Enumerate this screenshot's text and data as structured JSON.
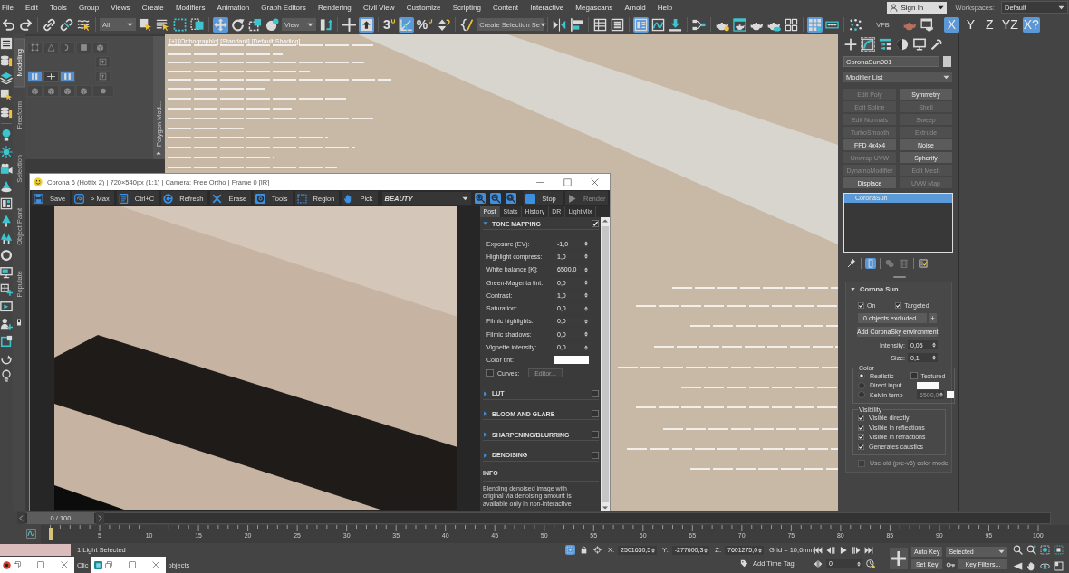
{
  "menu_bar": {
    "items": [
      "File",
      "Edit",
      "Tools",
      "Group",
      "Views",
      "Create",
      "Modifiers",
      "Animation",
      "Graph Editors",
      "Rendering",
      "Civil View",
      "Customize",
      "Scripting",
      "Content",
      "Interactive",
      "Megascans",
      "Arnold",
      "Help"
    ],
    "sign_in": "Sign In",
    "workspaces_label": "Workspaces:",
    "workspace": "Default"
  },
  "main_toolbar": {
    "buttons": [
      {
        "kind": "icon",
        "selected": false
      },
      {
        "kind": "icon",
        "selected": false
      },
      {
        "kind": "icon",
        "selected": false
      },
      {
        "kind": "icon",
        "selected": false
      },
      {
        "kind": "icon",
        "selected": false
      },
      {
        "kind": "dropdown",
        "value": "All"
      },
      {
        "kind": "icon",
        "selected": false
      },
      {
        "kind": "icon",
        "selected": false
      },
      {
        "kind": "icon",
        "selected": false
      },
      {
        "kind": "icon",
        "selected": false
      },
      {
        "kind": "icon",
        "selected": true
      },
      {
        "kind": "icon",
        "selected": false
      },
      {
        "kind": "icon",
        "selected": false
      },
      {
        "kind": "icon",
        "selected": false
      },
      {
        "kind": "dropdown",
        "value": "View"
      },
      {
        "kind": "icon",
        "selected": false
      },
      {
        "kind": "icon",
        "selected": false
      },
      {
        "kind": "icon",
        "selected": true
      },
      {
        "kind": "snap",
        "label": "3",
        "selected": false
      },
      {
        "kind": "icon",
        "selected": true
      },
      {
        "kind": "snap",
        "label": "%",
        "selected": false
      },
      {
        "kind": "icon",
        "selected": false
      },
      {
        "kind": "icon",
        "selected": false
      },
      {
        "kind": "dropdown",
        "value": "Create Selection Se"
      },
      {
        "kind": "icon",
        "selected": false
      },
      {
        "kind": "icon",
        "selected": false
      },
      {
        "kind": "icon",
        "selected": false
      },
      {
        "kind": "icon",
        "selected": false
      },
      {
        "kind": "icon",
        "selected": true
      },
      {
        "kind": "icon",
        "selected": false
      },
      {
        "kind": "icon",
        "selected": false
      },
      {
        "kind": "icon",
        "selected": false
      },
      {
        "kind": "icon",
        "selected": false
      },
      {
        "kind": "icon",
        "selected": false
      },
      {
        "kind": "icon",
        "selected": false
      },
      {
        "kind": "icon",
        "selected": false
      },
      {
        "kind": "icon",
        "selected": false
      },
      {
        "kind": "icon",
        "selected": true
      },
      {
        "kind": "icon",
        "selected": false
      },
      {
        "kind": "icon",
        "selected": false
      },
      {
        "kind": "text",
        "label": "VFB"
      },
      {
        "kind": "icon",
        "selected": false
      },
      {
        "kind": "icon",
        "selected": false
      },
      {
        "kind": "axis",
        "label": "X",
        "selected": true
      },
      {
        "kind": "axis",
        "label": "Y",
        "selected": false
      },
      {
        "kind": "axis",
        "label": "Z",
        "selected": false
      },
      {
        "kind": "axis",
        "label": "YZ",
        "selected": false
      },
      {
        "kind": "axis",
        "label": "X?",
        "selected": true
      }
    ]
  },
  "ribbon": {
    "tabs": [
      {
        "label": "Modeling",
        "selected": true
      },
      {
        "label": "Freeform",
        "selected": false
      },
      {
        "label": "Selection",
        "selected": false
      },
      {
        "label": "Object Paint",
        "selected": false
      },
      {
        "label": "Populate",
        "selected": false
      }
    ],
    "panel": {
      "title": "Polygon Mod...",
      "tools": [
        {
          "selected": false,
          "disabled": true
        },
        {
          "selected": false,
          "disabled": true
        },
        {
          "selected": false,
          "disabled": true
        },
        {
          "selected": false,
          "disabled": true
        },
        {
          "selected": false,
          "disabled": true
        },
        {
          "selected": false,
          "disabled": true
        },
        {
          "selected": true,
          "disabled": false
        },
        {
          "selected": false,
          "disabled": false
        },
        {
          "selected": true,
          "disabled": false
        },
        {
          "selected": false,
          "disabled": true
        },
        {
          "selected": false,
          "disabled": true
        },
        {
          "selected": false,
          "disabled": true
        },
        {
          "selected": false,
          "disabled": true
        },
        {
          "selected": false,
          "disabled": true
        },
        {
          "selected": false,
          "disabled": true
        }
      ]
    }
  },
  "viewport": {
    "labels": [
      "[+]",
      "[Orthographic]",
      "[Standard]",
      "[Default Shading]"
    ]
  },
  "render_window": {
    "title": "Corona 6 (Hotfix 2) | 720×540px (1:1) | Camera: Free Ortho | Frame 0 [IR]",
    "toolbar": [
      {
        "kind": "button",
        "label": "Save",
        "disabled": false
      },
      {
        "kind": "button",
        "label": "> Max",
        "disabled": false
      },
      {
        "kind": "button",
        "label": "Ctrl+C",
        "disabled": false
      },
      {
        "kind": "button",
        "label": "Refresh",
        "disabled": false
      },
      {
        "kind": "button",
        "label": "Erase",
        "disabled": false
      },
      {
        "kind": "button",
        "label": "Tools",
        "disabled": false
      },
      {
        "kind": "button",
        "label": "Region",
        "disabled": false
      },
      {
        "kind": "button",
        "label": "Pick",
        "disabled": false
      },
      {
        "kind": "dropdown",
        "value": "BEAUTY"
      },
      {
        "kind": "icon",
        "disabled": false
      },
      {
        "kind": "icon",
        "disabled": false
      },
      {
        "kind": "icon",
        "disabled": false
      },
      {
        "kind": "button",
        "label": "Stop",
        "disabled": false
      },
      {
        "kind": "button",
        "label": "Render",
        "disabled": true
      }
    ],
    "tabs": [
      {
        "label": "Post",
        "selected": true
      },
      {
        "label": "Stats",
        "selected": false
      },
      {
        "label": "History",
        "selected": false
      },
      {
        "label": "DR",
        "selected": false
      },
      {
        "label": "LightMix",
        "selected": false
      }
    ],
    "tone_mapping": {
      "title": "TONE MAPPING",
      "expanded": true,
      "enabled": true,
      "rows": [
        {
          "kind": "spinner",
          "label": "Exposure (EV):",
          "value": "-1,0"
        },
        {
          "kind": "spinner",
          "label": "Highlight compress:",
          "value": "1,0"
        },
        {
          "kind": "spinner",
          "label": "White balance [K]:",
          "value": "6500,0"
        },
        {
          "kind": "spinner",
          "label": "Green-Magenta tint:",
          "value": "0,0"
        },
        {
          "kind": "spinner",
          "label": "Contrast:",
          "value": "1,0"
        },
        {
          "kind": "spinner",
          "label": "Saturation:",
          "value": "0,0"
        },
        {
          "kind": "spinner",
          "label": "Filmic highlights:",
          "value": "0,0"
        },
        {
          "kind": "spinner",
          "label": "Filmic shadows:",
          "value": "0,0"
        },
        {
          "kind": "spinner",
          "label": "Vignette intensity:",
          "value": "0,0"
        },
        {
          "kind": "swatch",
          "label": "Color tint:"
        },
        {
          "kind": "curves",
          "label": "Curves:",
          "checked": false,
          "button": "Editor...",
          "button_disabled": true
        }
      ]
    },
    "sections": [
      {
        "title": "LUT",
        "expanded": false,
        "enabled": false
      },
      {
        "title": "BLOOM AND GLARE",
        "expanded": false,
        "enabled": false
      },
      {
        "title": "SHARPENING/BLURRING",
        "expanded": false,
        "enabled": false
      },
      {
        "title": "DENOISING",
        "expanded": false,
        "enabled": false
      }
    ],
    "info": {
      "title": "INFO",
      "text": "Blending denoised image with original via denoising amount is available only in non-interactive"
    }
  },
  "command_panel": {
    "tabs": [
      {
        "selected": false
      },
      {
        "selected": true
      },
      {
        "selected": false
      },
      {
        "selected": false
      },
      {
        "selected": false
      },
      {
        "selected": false
      }
    ],
    "object_name": "CoronaSun001",
    "modifier_list": "Modifier List",
    "modifiers": [
      {
        "label": "Edit Poly",
        "disabled": true
      },
      {
        "label": "Symmetry",
        "disabled": false
      },
      {
        "label": "Edit Spline",
        "disabled": true
      },
      {
        "label": "Shell",
        "disabled": true
      },
      {
        "label": "Edit Normals",
        "disabled": true
      },
      {
        "label": "Sweep",
        "disabled": true
      },
      {
        "label": "TurboSmooth",
        "disabled": true
      },
      {
        "label": "Extrude",
        "disabled": true
      },
      {
        "label": "FFD 4x4x4",
        "disabled": false
      },
      {
        "label": "Noise",
        "disabled": false
      },
      {
        "label": "Unwrap UVW",
        "disabled": true
      },
      {
        "label": "Spherify",
        "disabled": false
      },
      {
        "label": "DynamoModifier",
        "disabled": true
      },
      {
        "label": "Edit Mesh",
        "disabled": true
      },
      {
        "label": "Displace",
        "disabled": false
      },
      {
        "label": "UVW Map",
        "disabled": true
      }
    ],
    "stack": [
      {
        "label": "CoronaSun",
        "selected": true
      }
    ],
    "stack_tools": [
      {
        "selected": false,
        "disabled": false
      },
      {
        "selected": true,
        "disabled": false
      },
      {
        "selected": false,
        "disabled": true
      },
      {
        "selected": false,
        "disabled": true
      },
      {
        "selected": false,
        "disabled": false
      }
    ]
  },
  "corona_sun": {
    "title": "Corona Sun",
    "expanded": true,
    "checks": [
      {
        "label": "On",
        "checked": true
      },
      {
        "label": "Targeted",
        "checked": true
      }
    ],
    "exclude_button": "0 objects excluded...",
    "add_button": "+",
    "sky_button": "Add CoronaSky environment",
    "spinners": [
      {
        "label": "Intensity:",
        "value": "0,05"
      },
      {
        "label": "Size:",
        "value": "0,1"
      }
    ],
    "color_group": {
      "title": "Color",
      "modes": [
        {
          "label": "Realistic",
          "selected": true
        },
        {
          "label": "Direct input",
          "selected": false
        },
        {
          "label": "Kelvin temp",
          "selected": false
        }
      ],
      "textured": {
        "label": "Textured",
        "checked": false
      },
      "kelvin_value": "6500,0"
    },
    "visibility_group": {
      "title": "Visibility",
      "items": [
        {
          "label": "Visible directly",
          "checked": true
        },
        {
          "label": "Visible in reflections",
          "checked": true
        },
        {
          "label": "Visible in refractions",
          "checked": true
        },
        {
          "label": "Generates caustics",
          "checked": true
        }
      ]
    },
    "old_color_mode": {
      "label": "Use old (pre-v6) color mode",
      "checked": false,
      "disabled": true
    }
  },
  "timeline": {
    "time_slider": {
      "label": "0 / 100",
      "level": 0
    },
    "ruler_labels": [
      "5",
      "10",
      "15",
      "20",
      "25",
      "30",
      "35",
      "40",
      "45",
      "50",
      "55",
      "60",
      "65",
      "70",
      "75",
      "80",
      "85",
      "90",
      "95",
      "100"
    ]
  },
  "status_bar": {
    "selection": "1 Light Selected",
    "prompt_fragments": [
      "Clic",
      "objects"
    ],
    "toggles": [
      {
        "selected": true
      },
      {
        "selected": false
      },
      {
        "selected": false
      }
    ],
    "coords": [
      {
        "axis": "X:",
        "value": "2501630,5"
      },
      {
        "axis": "Y:",
        "value": "-277600,3"
      },
      {
        "axis": "Z:",
        "value": "7601275,0"
      }
    ],
    "grid": "Grid = 10,0mm",
    "time_tag": "Add Time Tag",
    "frame": "0",
    "auto_key": "Auto Key",
    "set_key": "Set Key",
    "key_set": "Selected",
    "key_filters": "Key Filters..."
  }
}
